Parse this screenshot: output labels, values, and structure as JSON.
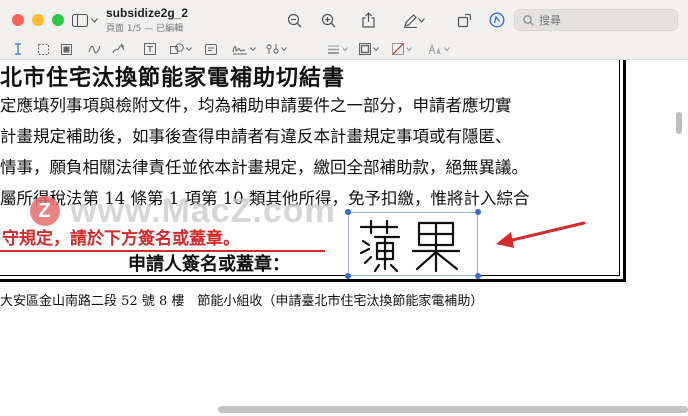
{
  "window": {
    "title": "subsidize2g_2",
    "subtitle": "頁面 1/5 — 已編輯"
  },
  "search": {
    "placeholder": "搜尋"
  },
  "document": {
    "heading": "北市住宅汰換節能家電補助切結書",
    "lines": [
      "定應填列事項與檢附文件，均為補助申請要件之一部分，申請者應切實",
      "計畫規定補助後，如事後查得申請者有違反本計畫規定事項或有隱匿、",
      "情事，願負相關法律責任並依本計畫規定，繳回全部補助款，絕無異議。",
      "屬所得稅法第 14 條第 1 項第 10 類其他所得，免予扣繳，惟將計入綜合"
    ],
    "warning": "守規定，請於下方簽名或蓋章。",
    "applicant_label": "申請人簽名或蓋章：",
    "signature": "蘋果",
    "address": "大安區金山南路二段 52 號 8 樓　節能小組收（申請臺北市住宅汰換節能家電補助）"
  },
  "watermark": {
    "badge": "Z",
    "text": "www.MacZ.com"
  },
  "colors": {
    "accent": "#2f6fd4",
    "warning": "#d42a2a",
    "arrow": "#d42a2a"
  }
}
